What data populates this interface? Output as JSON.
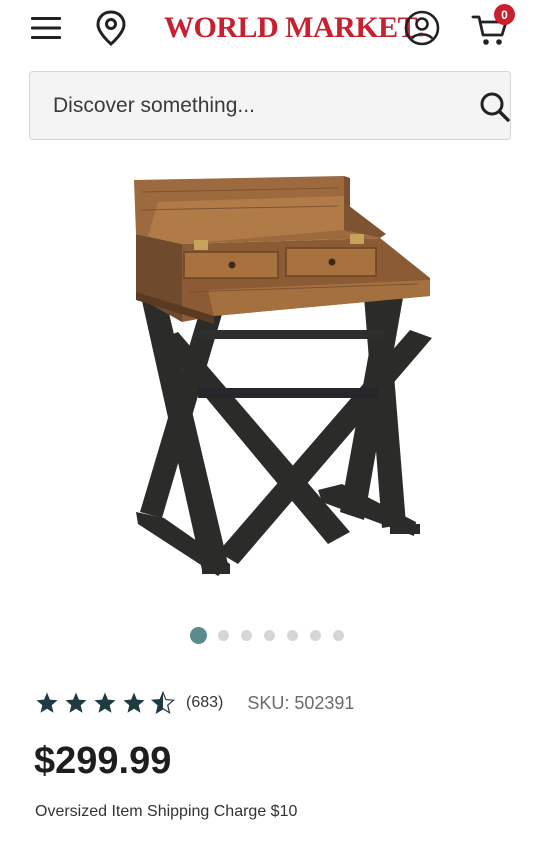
{
  "header": {
    "logo_text": "World Market",
    "logo_mark": "®",
    "cart_count": "0",
    "icons": {
      "menu": "hamburger-menu-icon",
      "location": "map-pin-icon",
      "account": "account-circle-icon",
      "cart": "shopping-cart-icon"
    }
  },
  "search": {
    "placeholder": "Discover something...",
    "value": "",
    "icon": "search-icon"
  },
  "product": {
    "image": "writing-desk-photo",
    "carousel": {
      "total_slides": 7,
      "active_index": 0
    },
    "rating": {
      "value": 4.5,
      "max": 5,
      "review_count": "(683)"
    },
    "sku": "SKU: 502391",
    "price": "$299.99",
    "shipping_note": "Oversized Item Shipping Charge $10"
  },
  "colors": {
    "brand_red": "#c8202f",
    "star_dark": "#1f3a40",
    "carousel_active": "#5a8c8e",
    "carousel_inactive": "#d6d6d6"
  }
}
